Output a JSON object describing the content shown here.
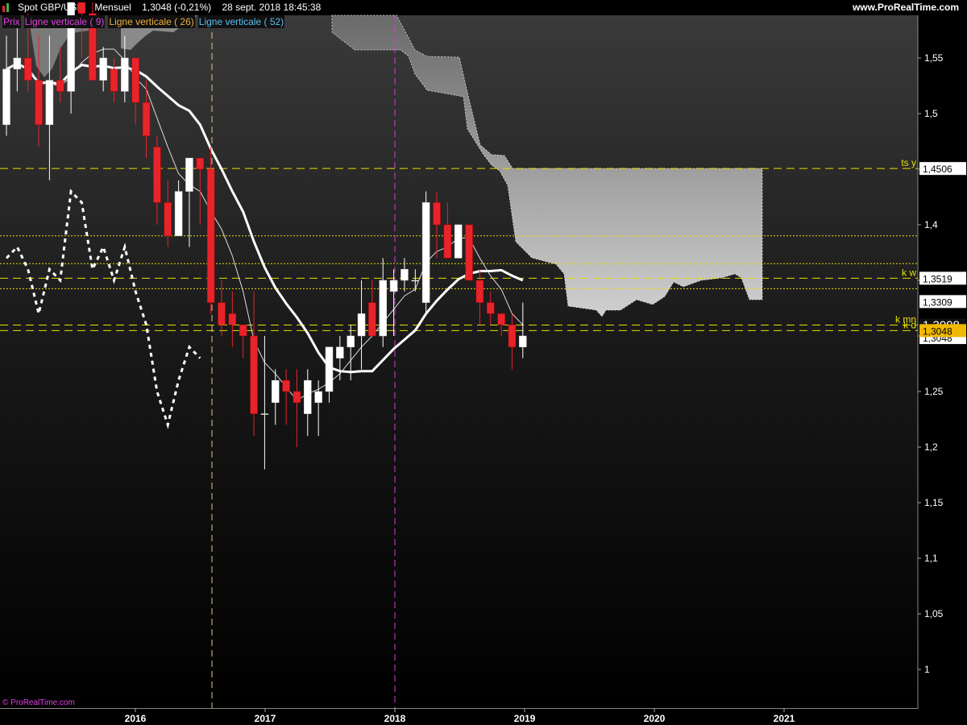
{
  "header": {
    "symbol": "Spot GBP/USD",
    "period": "Mensuel",
    "last": "1,3048 (-0,21%)",
    "datetime": "28 sept. 2018 18:45:38",
    "site": "www.ProRealTime.com"
  },
  "legend": [
    {
      "label": "Prix",
      "color": "#e040e0"
    },
    {
      "label": "Ligne verticale ( 9)",
      "color": "#e040e0"
    },
    {
      "label": "Ligne verticale ( 26)",
      "color": "#f0b040"
    },
    {
      "label": "Ligne verticale ( 52)",
      "color": "#5bc0f0"
    }
  ],
  "watermark": "© ProRealTime.com",
  "colors": {
    "up": "#ffffff",
    "down": "#e8242a",
    "kumo": "#a8a8a8",
    "level": "#e8e000",
    "magenta": "#d040d0"
  },
  "chart_data": {
    "type": "candlestick",
    "x_ticks": [
      "2016",
      "2017",
      "2018",
      "2019",
      "2020",
      "2021"
    ],
    "y_ticks": [
      "1",
      "1,05",
      "1,1",
      "1,15",
      "1,2",
      "1,25",
      "1,3",
      "1,35",
      "1,4",
      "1,45",
      "1,5",
      "1,55"
    ],
    "ylim": [
      0.98,
      1.58
    ],
    "candles": [
      {
        "t": "2015-04",
        "o": 1.49,
        "h": 1.57,
        "l": 1.48,
        "c": 1.54
      },
      {
        "t": "2015-05",
        "o": 1.54,
        "h": 1.58,
        "l": 1.52,
        "c": 1.55
      },
      {
        "t": "2015-06",
        "o": 1.55,
        "h": 1.59,
        "l": 1.52,
        "c": 1.53
      },
      {
        "t": "2015-07",
        "o": 1.53,
        "h": 1.57,
        "l": 1.47,
        "c": 1.49
      },
      {
        "t": "2015-08",
        "o": 1.49,
        "h": 1.57,
        "l": 1.44,
        "c": 1.53
      },
      {
        "t": "2015-09",
        "o": 1.53,
        "h": 1.56,
        "l": 1.51,
        "c": 1.52
      },
      {
        "t": "2015-10",
        "o": 1.52,
        "h": 1.6,
        "l": 1.5,
        "c": 1.6
      },
      {
        "t": "2015-11",
        "o": 1.6,
        "h": 1.6,
        "l": 1.55,
        "c": 1.59
      },
      {
        "t": "2015-12",
        "o": 1.59,
        "h": 1.6,
        "l": 1.54,
        "c": 1.53
      },
      {
        "t": "2016-01",
        "o": 1.53,
        "h": 1.56,
        "l": 1.52,
        "c": 1.55
      },
      {
        "t": "2016-02",
        "o": 1.54,
        "h": 1.55,
        "l": 1.51,
        "c": 1.52
      },
      {
        "t": "2016-03",
        "o": 1.52,
        "h": 1.57,
        "l": 1.51,
        "c": 1.55
      },
      {
        "t": "2016-04",
        "o": 1.55,
        "h": 1.55,
        "l": 1.49,
        "c": 1.51
      },
      {
        "t": "2016-05",
        "o": 1.51,
        "h": 1.53,
        "l": 1.46,
        "c": 1.48
      },
      {
        "t": "2016-06",
        "o": 1.47,
        "h": 1.48,
        "l": 1.4,
        "c": 1.42
      },
      {
        "t": "2016-07",
        "o": 1.42,
        "h": 1.44,
        "l": 1.38,
        "c": 1.39
      },
      {
        "t": "2016-08",
        "o": 1.39,
        "h": 1.44,
        "l": 1.39,
        "c": 1.43
      },
      {
        "t": "2016-09",
        "o": 1.43,
        "h": 1.46,
        "l": 1.38,
        "c": 1.46
      },
      {
        "t": "2016-10",
        "o": 1.46,
        "h": 1.46,
        "l": 1.4,
        "c": 1.45
      },
      {
        "t": "2016-11",
        "o": 1.45,
        "h": 1.47,
        "l": 1.32,
        "c": 1.33
      },
      {
        "t": "2016-12",
        "o": 1.33,
        "h": 1.35,
        "l": 1.3,
        "c": 1.31
      },
      {
        "t": "2017-01",
        "o": 1.32,
        "h": 1.34,
        "l": 1.29,
        "c": 1.31
      },
      {
        "t": "2017-02",
        "o": 1.31,
        "h": 1.31,
        "l": 1.28,
        "c": 1.3
      },
      {
        "t": "2017-03",
        "o": 1.3,
        "h": 1.34,
        "l": 1.21,
        "c": 1.23
      },
      {
        "t": "2017-04",
        "o": 1.23,
        "h": 1.3,
        "l": 1.18,
        "c": 1.23
      },
      {
        "t": "2017-05",
        "o": 1.24,
        "h": 1.27,
        "l": 1.22,
        "c": 1.26
      },
      {
        "t": "2017-06",
        "o": 1.26,
        "h": 1.27,
        "l": 1.22,
        "c": 1.25
      },
      {
        "t": "2017-07",
        "o": 1.25,
        "h": 1.27,
        "l": 1.2,
        "c": 1.24
      },
      {
        "t": "2017-08",
        "o": 1.23,
        "h": 1.27,
        "l": 1.21,
        "c": 1.26
      },
      {
        "t": "2017-09",
        "o": 1.24,
        "h": 1.26,
        "l": 1.21,
        "c": 1.25
      },
      {
        "t": "2017-10",
        "o": 1.25,
        "h": 1.29,
        "l": 1.24,
        "c": 1.29
      },
      {
        "t": "2017-11",
        "o": 1.28,
        "h": 1.3,
        "l": 1.26,
        "c": 1.29
      },
      {
        "t": "2017-12",
        "o": 1.29,
        "h": 1.31,
        "l": 1.26,
        "c": 1.3
      },
      {
        "t": "2018-01",
        "o": 1.3,
        "h": 1.35,
        "l": 1.27,
        "c": 1.32
      },
      {
        "t": "2018-02",
        "o": 1.33,
        "h": 1.35,
        "l": 1.3,
        "c": 1.3
      },
      {
        "t": "2018-03",
        "o": 1.3,
        "h": 1.37,
        "l": 1.29,
        "c": 1.35
      },
      {
        "t": "2018-04",
        "o": 1.34,
        "h": 1.36,
        "l": 1.3,
        "c": 1.35
      },
      {
        "t": "2018-05",
        "o": 1.35,
        "h": 1.37,
        "l": 1.34,
        "c": 1.36
      },
      {
        "t": "2018-06",
        "o": 1.35,
        "h": 1.36,
        "l": 1.34,
        "c": 1.35
      },
      {
        "t": "2018-07",
        "o": 1.33,
        "h": 1.43,
        "l": 1.32,
        "c": 1.42
      },
      {
        "t": "2018-08",
        "o": 1.42,
        "h": 1.43,
        "l": 1.37,
        "c": 1.4
      },
      {
        "t": "2018-09",
        "o": 1.4,
        "h": 1.42,
        "l": 1.37,
        "c": 1.37
      },
      {
        "t": "2018-10",
        "o": 1.37,
        "h": 1.4,
        "l": 1.37,
        "c": 1.4
      },
      {
        "t": "2018-11",
        "o": 1.4,
        "h": 1.4,
        "l": 1.35,
        "c": 1.35
      },
      {
        "t": "2018-12",
        "o": 1.35,
        "h": 1.36,
        "l": 1.31,
        "c": 1.33
      },
      {
        "t": "2019-01",
        "o": 1.33,
        "h": 1.34,
        "l": 1.31,
        "c": 1.32
      },
      {
        "t": "2019-02",
        "o": 1.32,
        "h": 1.32,
        "l": 1.3,
        "c": 1.31
      },
      {
        "t": "2019-03",
        "o": 1.31,
        "h": 1.32,
        "l": 1.27,
        "c": 1.29
      },
      {
        "t": "2019-04",
        "o": 1.29,
        "h": 1.33,
        "l": 1.28,
        "c": 1.3
      }
    ],
    "levels": [
      {
        "value": 1.4506,
        "label": "ts y",
        "price_label": "1,4506",
        "style": "dash"
      },
      {
        "value": 1.39,
        "label": "",
        "price_label": "",
        "style": "dot"
      },
      {
        "value": 1.365,
        "label": "",
        "price_label": "",
        "style": "dot"
      },
      {
        "value": 1.3519,
        "label": "k w",
        "price_label": "1,3519",
        "style": "dash"
      },
      {
        "value": 1.3425,
        "label": "",
        "price_label": "",
        "style": "dot"
      },
      {
        "value": 1.3098,
        "label": "k mn",
        "price_label": "",
        "style": "dash"
      },
      {
        "value": 1.3048,
        "label": "k d",
        "price_label": "",
        "style": "dash"
      }
    ],
    "price_labels": {
      "level_1_3309": "1,3309",
      "current": "1,3098",
      "last": "1,3048",
      "partial": "1,3048"
    },
    "vlines": [
      {
        "t": "2016-08",
        "color": "#f0c080"
      },
      {
        "t": "2018-01",
        "color": "#d040d0"
      }
    ]
  }
}
